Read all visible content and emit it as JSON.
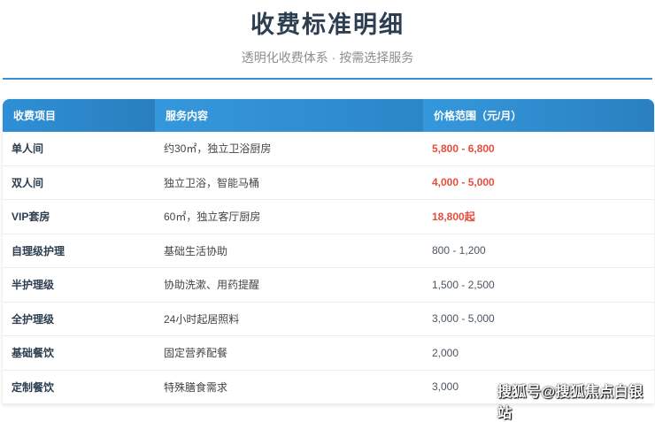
{
  "header": {
    "title": "收费标准明细",
    "subtitle": "透明化收费体系 · 按需选择服务"
  },
  "table": {
    "columns": [
      "收费项目",
      "服务内容",
      "价格范围（元/月）"
    ],
    "rows": [
      {
        "item": "单人间",
        "service": "约30㎡，独立卫浴厨房",
        "price": "5,800 - 6,800",
        "highlight": true
      },
      {
        "item": "双人间",
        "service": "独立卫浴，智能马桶",
        "price": "4,000 - 5,000",
        "highlight": true
      },
      {
        "item": "VIP套房",
        "service": "60㎡，独立客厅厨房",
        "price": "18,800起",
        "highlight": true
      },
      {
        "item": "自理级护理",
        "service": "基础生活协助",
        "price": "800 - 1,200",
        "highlight": false
      },
      {
        "item": "半护理级",
        "service": "协助洗漱、用药提醒",
        "price": "1,500 - 2,500",
        "highlight": false
      },
      {
        "item": "全护理级",
        "service": "24小时起居照料",
        "price": "3,000 - 5,000",
        "highlight": false
      },
      {
        "item": "基础餐饮",
        "service": "固定营养配餐",
        "price": "2,000",
        "highlight": false
      },
      {
        "item": "定制餐饮",
        "service": "特殊膳食需求",
        "price": "3,000",
        "highlight": false
      }
    ]
  },
  "colors": {
    "accent": "#2f8fd4",
    "price_highlight": "#e74c3c",
    "title": "#2c3e50"
  },
  "watermark": "搜狐号@搜狐焦点白银站"
}
